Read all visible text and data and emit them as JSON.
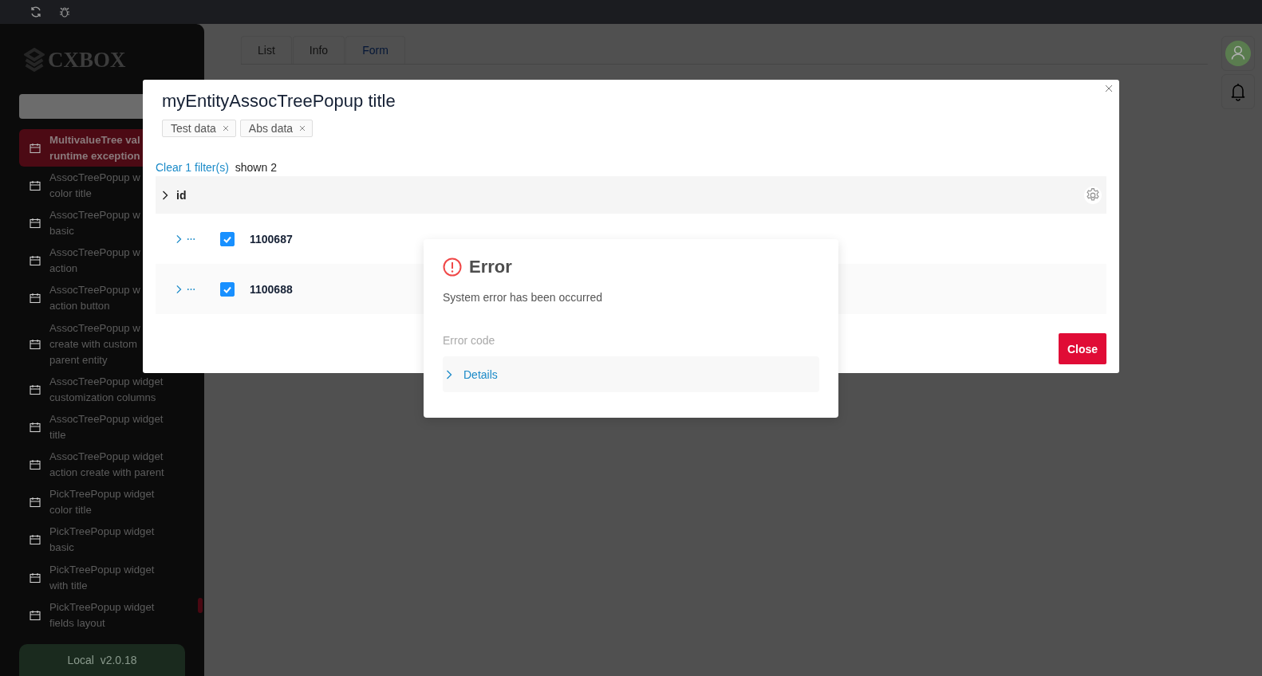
{
  "logo_text": "CXBOX",
  "sidebar": {
    "items": [
      {
        "lines": [
          "MultivalueTree val",
          "runtime exception"
        ],
        "selected": true
      },
      {
        "lines": [
          "AssocTreePopup w",
          "color title"
        ],
        "selected": false
      },
      {
        "lines": [
          "AssocTreePopup w",
          "basic"
        ],
        "selected": false
      },
      {
        "lines": [
          "AssocTreePopup w",
          "action"
        ],
        "selected": false
      },
      {
        "lines": [
          "AssocTreePopup w",
          "action button"
        ],
        "selected": false
      },
      {
        "lines": [
          "AssocTreePopup w",
          "create with custom",
          "parent entity"
        ],
        "selected": false
      },
      {
        "lines": [
          "AssocTreePopup widget",
          "customization columns"
        ],
        "selected": false
      },
      {
        "lines": [
          "AssocTreePopup widget",
          "title"
        ],
        "selected": false
      },
      {
        "lines": [
          "AssocTreePopup widget",
          "action create with parent"
        ],
        "selected": false
      },
      {
        "lines": [
          "PickTreePopup widget",
          "color title"
        ],
        "selected": false
      },
      {
        "lines": [
          "PickTreePopup widget",
          "basic"
        ],
        "selected": false
      },
      {
        "lines": [
          "PickTreePopup widget",
          "with title"
        ],
        "selected": false
      },
      {
        "lines": [
          "PickTreePopup widget",
          "fields layout"
        ],
        "selected": false
      }
    ],
    "version": "Local  v2.0.18"
  },
  "tabs": [
    {
      "label": "List",
      "selected": false
    },
    {
      "label": "Info",
      "selected": false
    },
    {
      "label": "Form",
      "selected": true
    }
  ],
  "popup": {
    "title": "myEntityAssocTreePopup title",
    "tags": [
      "Test data",
      "Abs data"
    ],
    "clear_filters": "Clear 1 filter(s)",
    "shown": "shown 2",
    "column_header": "id",
    "rows": [
      {
        "id": "1100687",
        "checked": true
      },
      {
        "id": "1100688",
        "checked": true
      }
    ],
    "close_button": "Close"
  },
  "error": {
    "title": "Error",
    "message": "System error has been occurred",
    "code_label": "Error code",
    "details": {
      "label": "Details",
      "expanded": false
    }
  }
}
